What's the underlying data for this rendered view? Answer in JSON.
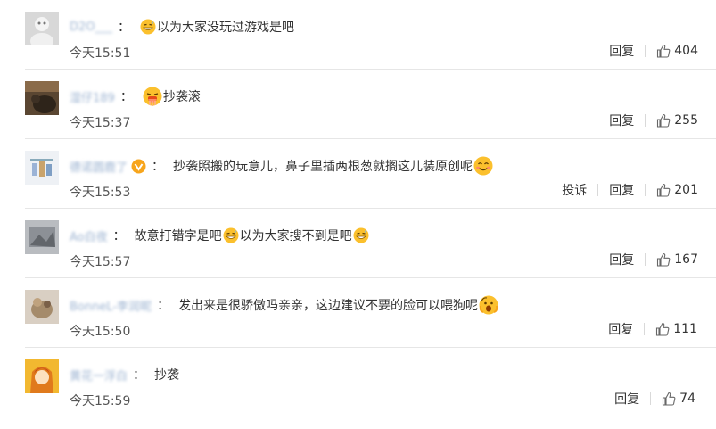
{
  "reply_label": "回复",
  "report_label": "投诉",
  "comments": [
    {
      "username": "D2O___",
      "separator": "：",
      "text": "以为大家没玩过游戏是吧",
      "time": "今天15:51",
      "likes": "404"
    },
    {
      "username": "湿仔189",
      "separator": "：",
      "text": "抄袭滚",
      "time": "今天15:37",
      "likes": "255"
    },
    {
      "username": "德诺圆鹿了",
      "separator": "：",
      "text": "抄袭照搬的玩意儿，鼻子里插两根葱就搁这儿装原创呢",
      "time": "今天15:53",
      "likes": "201"
    },
    {
      "username": "Ao白夜",
      "separator": "：",
      "text_part1": "故意打错字是吧",
      "text_part2": "以为大家搜不到是吧",
      "time": "今天15:57",
      "likes": "167"
    },
    {
      "username": "BonneL-李润昵",
      "separator": "：",
      "text": "发出来是很骄傲吗亲亲，这边建议不要的脸可以喂狗呢",
      "time": "今天15:50",
      "likes": "111"
    },
    {
      "username": "黄花一浮白",
      "separator": "：",
      "text": "抄袭",
      "time": "今天15:59",
      "likes": "74"
    }
  ]
}
